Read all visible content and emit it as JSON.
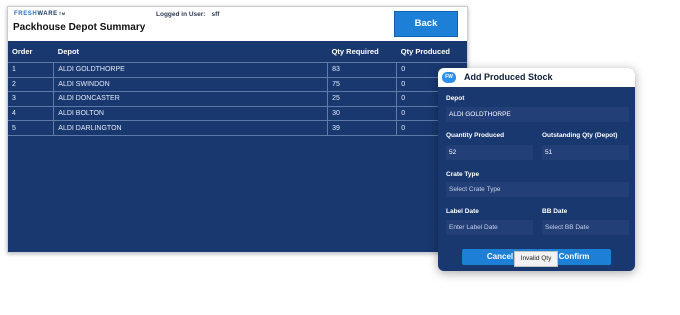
{
  "header": {
    "logo_part1": "FRESH",
    "logo_part2": "WARE",
    "logo_tm": "TM",
    "logged_in_label": "Logged in User:",
    "logged_in_user": "sff",
    "page_title": "Packhouse Depot Summary",
    "back_label": "Back"
  },
  "table": {
    "columns": [
      "Order",
      "Depot",
      "Qty Required",
      "Qty Produced"
    ],
    "rows": [
      [
        "1",
        "ALDI GOLDTHORPE",
        "83",
        "0"
      ],
      [
        "2",
        "ALDI SWINDON",
        "75",
        "0"
      ],
      [
        "3",
        "ALDI DONCASTER",
        "25",
        "0"
      ],
      [
        "4",
        "ALDI BOLTON",
        "30",
        "0"
      ],
      [
        "5",
        "ALDI DARLINGTON",
        "39",
        "0"
      ]
    ]
  },
  "modal": {
    "badge": "FW",
    "title": "Add Produced Stock",
    "depot_label": "Depot",
    "depot_value": "ALDI GOLDTHORPE",
    "qty_produced_label": "Quantity Produced",
    "qty_produced_value": "52",
    "outstanding_label": "Outstanding Qty (Depot)",
    "outstanding_value": "51",
    "crate_type_label": "Crate Type",
    "crate_type_placeholder": "Select Crate Type",
    "label_date_label": "Label Date",
    "label_date_placeholder": "Enter Label Date",
    "bb_date_label": "BB Date",
    "bb_date_placeholder": "Select BB Date",
    "cancel_label": "Cancel",
    "confirm_label": "Confirm",
    "tooltip": "Invalid Qty"
  },
  "colors": {
    "panel_bg": "#1a3870",
    "button_blue": "#1e7fd6",
    "field_bg": "#223f78"
  }
}
